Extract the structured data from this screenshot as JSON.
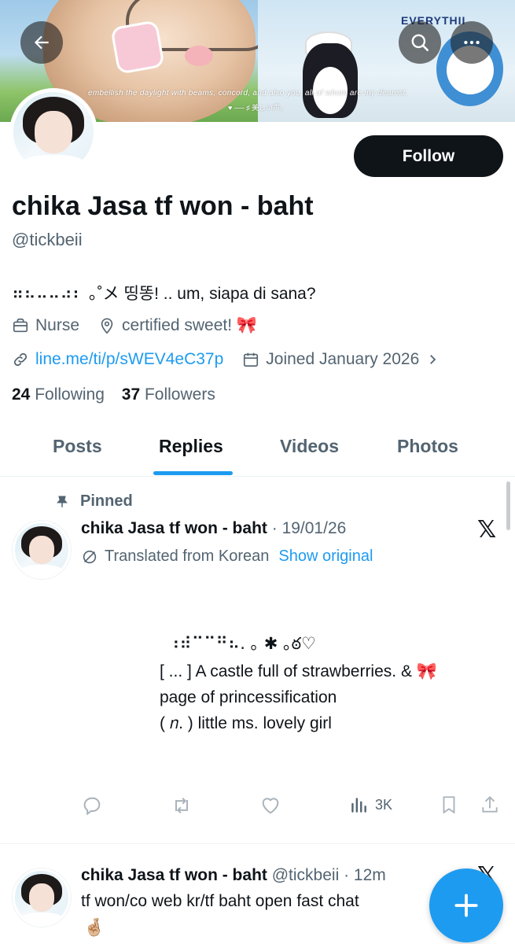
{
  "banner": {
    "caption": "embellish the daylight with beams, concord, and also you, all of whom are my dearest.",
    "caption2": "♥ ── ♯ 美しい声。",
    "corner_text": "EVERYTHII"
  },
  "header": {
    "back_icon": "arrow-left-icon",
    "search_icon": "search-icon",
    "more_icon": "more-horizontal-icon"
  },
  "profile": {
    "display_name": "chika Jasa tf won - baht",
    "handle": "@tickbeii",
    "bio": "⠶⠦⠤⠤⠴⠆ ｡˚メ 띵똥! .. um, siapa di sana?",
    "occupation": "Nurse",
    "location": "certified sweet! 🎀",
    "link": "line.me/ti/p/sWEV4eC37p",
    "joined": "Joined January 2026",
    "follow_label": "Follow",
    "following_count": "24",
    "following_label": "Following",
    "followers_count": "37",
    "followers_label": "Followers"
  },
  "tabs": [
    {
      "label": "Posts",
      "active": false
    },
    {
      "label": "Replies",
      "active": true
    },
    {
      "label": "Videos",
      "active": false
    },
    {
      "label": "Photos",
      "active": false
    }
  ],
  "posts": [
    {
      "pinned_label": "Pinned",
      "author": "chika Jasa tf won - baht",
      "date": "19/01/26",
      "translated_label": "Translated from Korean",
      "show_original_label": "Show original",
      "deco_line": "⠰⠾⠉⠉⠛⠦. ｡ ✱ ｡ఠ♡",
      "body_lines": [
        "[ ... ] A castle full of strawberries. & 🎀",
        "page of princessification",
        "( 𝑛. ) little  ms.  lovely  girl"
      ],
      "views": "3K"
    },
    {
      "author": "chika Jasa tf won - baht",
      "handle": "@tickbeii",
      "time": "12m",
      "text": "tf won/co web kr/tf baht open fast chat",
      "emoji": "🤞🏼"
    }
  ],
  "colors": {
    "accent": "#1d9bf0",
    "text": "#0f1419",
    "muted": "#536471",
    "follow_bg": "#0f1419"
  }
}
